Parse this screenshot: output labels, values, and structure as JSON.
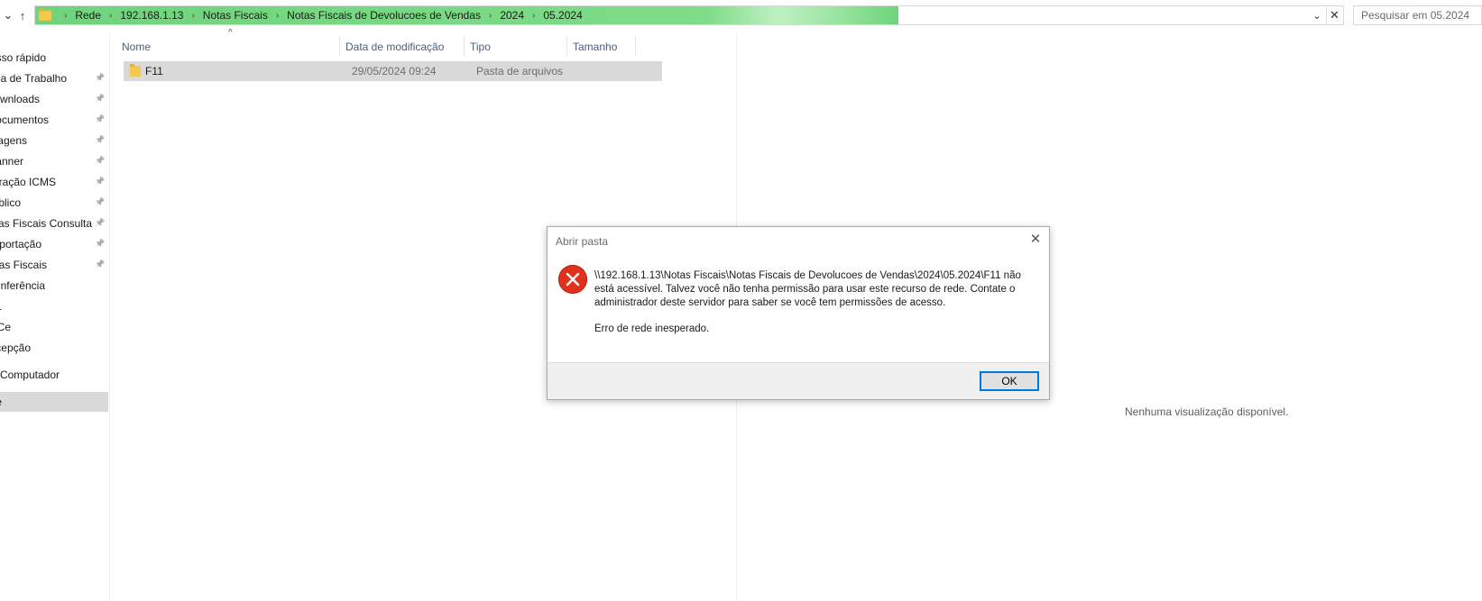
{
  "address": {
    "breadcrumbs": [
      "Rede",
      "192.168.1.13",
      "Notas Fiscais",
      "Notas Fiscais de Devolucoes de Vendas",
      "2024",
      "05.2024"
    ],
    "progress": 0.66
  },
  "search": {
    "placeholder": "Pesquisar em 05.2024"
  },
  "nav": {
    "items": [
      {
        "label": "sso rápido",
        "pinned": false
      },
      {
        "label": "ea de Trabalho",
        "pinned": true
      },
      {
        "label": "wnloads",
        "pinned": true
      },
      {
        "label": "ocumentos",
        "pinned": true
      },
      {
        "label": "agens",
        "pinned": true
      },
      {
        "label": "anner",
        "pinned": true
      },
      {
        "label": "uração ICMS",
        "pinned": true
      },
      {
        "label": "blico",
        "pinned": true
      },
      {
        "label": "otas Fiscais Consulta",
        "pinned": true
      },
      {
        "label": "portação",
        "pinned": true
      },
      {
        "label": "otas Fiscais",
        "pinned": true
      },
      {
        "label": "nferência",
        "pinned": false
      },
      {
        "label": "1",
        "pinned": false
      },
      {
        "label": "Ce",
        "pinned": false
      },
      {
        "label": "cepção",
        "pinned": false
      },
      {
        "label": "Computador",
        "pinned": false
      },
      {
        "label": "e",
        "pinned": false
      }
    ]
  },
  "columns": {
    "name": "Nome",
    "date": "Data de modificação",
    "type": "Tipo",
    "size": "Tamanho"
  },
  "files": [
    {
      "name": "F11",
      "date": "29/05/2024 09:24",
      "type": "Pasta de arquivos",
      "size": ""
    }
  ],
  "preview": {
    "message": "Nenhuma visualização disponível."
  },
  "dialog": {
    "title": "Abrir pasta",
    "message": "\\\\192.168.1.13\\Notas Fiscais\\Notas Fiscais de Devolucoes de Vendas\\2024\\05.2024\\F11 não está acessível. Talvez você não tenha permissão para usar este recurso de rede. Contate o administrador deste servidor para saber se você tem permissões de acesso.",
    "detail": "Erro de rede inesperado.",
    "ok_label": "OK"
  },
  "colors": {
    "progress": "#6fd47b",
    "selection": "#d9d9d9",
    "error": "#e0301e",
    "accent": "#0078d7"
  }
}
